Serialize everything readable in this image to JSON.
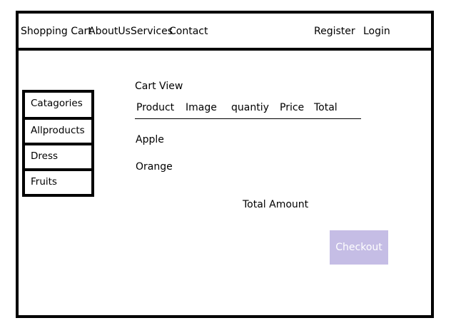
{
  "header": {
    "brand": "Shopping Cart",
    "nav": [
      "AboutUs",
      "Services",
      "Contact"
    ],
    "register": "Register",
    "login": "Login"
  },
  "sidebar": {
    "items": [
      "Catagories",
      "Allproducts",
      "Dress",
      "Fruits"
    ]
  },
  "cart": {
    "title": "Cart View",
    "columns": [
      "Product",
      "Image",
      "quantiy",
      "Price",
      "Total"
    ],
    "rows": [
      "Apple",
      "Orange"
    ],
    "total_label": "Total Amount",
    "checkout_label": "Checkout"
  },
  "colors": {
    "border": "#000000",
    "checkout_bg": "#c5bde5",
    "checkout_text": "#ffffff"
  }
}
